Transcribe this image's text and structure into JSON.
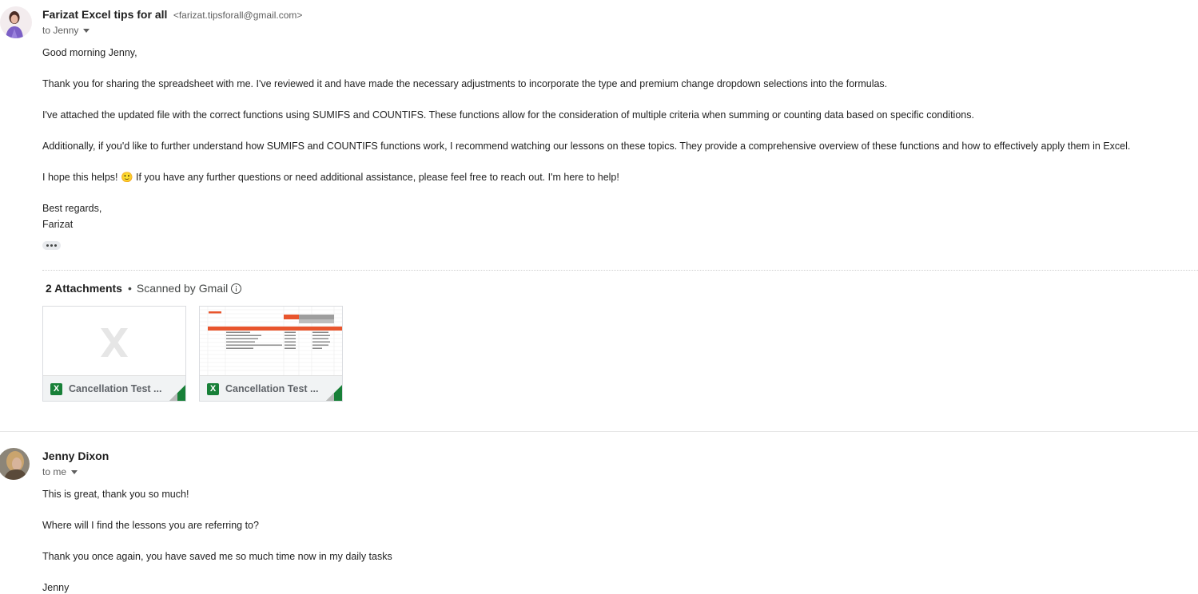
{
  "message1": {
    "sender_name": "Farizat Excel tips for all",
    "sender_email": "<farizat.tipsforall@gmail.com>",
    "recipient_line": "to Jenny",
    "body": [
      "Good morning Jenny,",
      "Thank you for sharing the spreadsheet with me. I've reviewed it and have made the necessary adjustments to incorporate the type and premium change dropdown selections into the formulas.",
      "I've attached the updated file with the correct functions using SUMIFS and COUNTIFS. These functions allow for the consideration of multiple criteria when summing or counting data based on specific conditions.",
      "Additionally, if you'd like to further understand how SUMIFS and COUNTIFS functions work, I recommend watching our lessons on these topics. They provide a comprehensive overview of these functions and how to effectively apply them in Excel.",
      "I hope this helps! 🙂 If you have any further questions or need additional assistance, please feel free to reach out. I'm here to help!",
      "Best regards,",
      "Farizat"
    ],
    "attachments_header": {
      "count_label": "2 Attachments",
      "separator": "•",
      "scan_label": "Scanned by Gmail"
    },
    "attachments": [
      {
        "file_name": "Cancellation Test ...",
        "icon_letter": "X",
        "preview": "generic-excel-icon"
      },
      {
        "file_name": "Cancellation Test ...",
        "icon_letter": "X",
        "preview": "spreadsheet-thumbnail"
      }
    ]
  },
  "message2": {
    "sender_name": "Jenny Dixon",
    "recipient_line": "to me",
    "body": [
      "This is great, thank you so much!",
      "Where will I find the lessons you are referring to?",
      "Thank you once again, you have saved me so much time now in my daily tasks",
      "Jenny"
    ]
  },
  "colors": {
    "excel_green": "#188038",
    "sheet_header_orange": "#e8552d",
    "text": "#222222",
    "muted": "#5e5e5e"
  }
}
